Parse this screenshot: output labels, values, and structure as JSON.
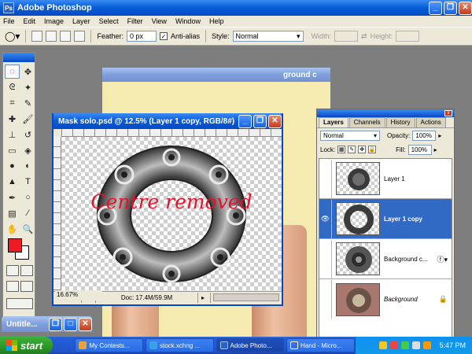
{
  "app": {
    "title": "Adobe Photoshop"
  },
  "menu": [
    "File",
    "Edit",
    "Image",
    "Layer",
    "Select",
    "Filter",
    "View",
    "Window",
    "Help"
  ],
  "options": {
    "feather_label": "Feather:",
    "feather_value": "0 px",
    "antialias_label": "Anti-alias",
    "style_label": "Style:",
    "style_value": "Normal",
    "width_label": "Width:",
    "height_label": "Height:"
  },
  "background_doc": {
    "title": "ground c"
  },
  "document": {
    "title": "Mask solo.psd @ 12.5% (Layer 1 copy, RGB/8#)",
    "canvas_text": "Centre removed",
    "zoom": "12.5%",
    "doc_info": "Doc: 17.4M/59.9M"
  },
  "background_zoom": "16.67%",
  "layers_panel": {
    "tabs": [
      "Layers",
      "Channels",
      "History",
      "Actions"
    ],
    "blend_mode": "Normal",
    "opacity_label": "Opacity:",
    "opacity_value": "100%",
    "lock_label": "Lock:",
    "fill_label": "Fill:",
    "fill_value": "100%",
    "layers": [
      {
        "name": "Layer 1",
        "visible": false,
        "selected": false
      },
      {
        "name": "Layer 1 copy",
        "visible": true,
        "selected": true
      },
      {
        "name": "Background c...",
        "visible": false,
        "selected": false
      },
      {
        "name": "Background",
        "visible": false,
        "selected": false
      }
    ]
  },
  "minimized_window": {
    "title": "Untitle..."
  },
  "taskbar": {
    "start_label": "start",
    "tasks": [
      {
        "label": "My Contests...",
        "color": "#e8a33d"
      },
      {
        "label": "stock.xchng ...",
        "color": "#3aa0e8"
      },
      {
        "label": "Adobe Photo...",
        "color": "#2a62c4"
      },
      {
        "label": "Hand - Micro...",
        "color": "#3b6fd6"
      }
    ],
    "clock": "5:47 PM"
  }
}
